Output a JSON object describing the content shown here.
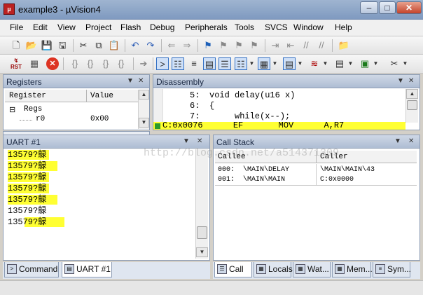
{
  "window": {
    "title": "example3 - µVision4",
    "minimize_glyph": "–",
    "maximize_glyph": "□",
    "close_glyph": "✕"
  },
  "menu": [
    "File",
    "Edit",
    "View",
    "Project",
    "Flash",
    "Debug",
    "Peripherals",
    "Tools",
    "SVCS",
    "Window",
    "Help"
  ],
  "toolbar1": {
    "icons": [
      "new-file-icon",
      "open-folder-icon",
      "save-icon",
      "save-all-icon",
      "cut-icon",
      "copy-icon",
      "paste-icon",
      "undo-icon",
      "redo-icon",
      "nav-back-icon",
      "nav-forward-icon",
      "bookmark-icon",
      "bookmark-prev-icon",
      "bookmark-next-icon",
      "bookmark-clear-icon",
      "indent-icon",
      "unindent-icon",
      "comment-icon",
      "uncomment-icon",
      "find-in-files-icon"
    ]
  },
  "toolbar2": {
    "reset_label": "RST",
    "glyphs": {
      "run": "▦",
      "stop": "✕",
      "step_in": "{}",
      "step_over": "{}",
      "step_out": "{}",
      "run_to_cursor": "{}",
      "show_next": "➔",
      "command_window": ">",
      "disassembly_window": "☷",
      "symbols_window": "≡",
      "registers_window": "▤",
      "call_stack_window": "☰",
      "watch_window": "☷",
      "memory_window": "▦",
      "serial_window": "▤",
      "analysis_window": "≋",
      "trace_window": "▤",
      "system_viewer": "▣",
      "toolbox": "✂"
    }
  },
  "registers": {
    "title": "Registers",
    "col_register": "Register",
    "col_value": "Value",
    "tree_toggle": "⊟",
    "group": "Regs",
    "rows": [
      {
        "name": "r0",
        "value": "0x00"
      }
    ]
  },
  "disassembly": {
    "title": "Disassembly",
    "lines": [
      {
        "num": "5:",
        "code": "void delay(u16 x)"
      },
      {
        "num": "6:",
        "code": "{"
      },
      {
        "num": "7:",
        "code": "     while(x--);"
      }
    ],
    "current_line": "C:0x0076      EF       MOV      A,R7"
  },
  "uart": {
    "title": "UART #1",
    "lines": [
      "13579?鵦",
      "13579?鵦",
      "13579?鵦",
      "13579?鵦",
      "13579?鵦",
      "13579?鵦",
      "13579?鵦"
    ]
  },
  "callstack": {
    "title": "Call Stack",
    "col_callee": "Callee",
    "col_caller": "Caller",
    "rows": [
      {
        "callee": "000:  \\MAIN\\DELAY",
        "caller": "\\MAIN\\MAIN\\43"
      },
      {
        "callee": "001:  \\MAIN\\MAIN",
        "caller": "C:0x0000"
      }
    ]
  },
  "bottom_tabs_left": [
    "Command",
    "UART #1"
  ],
  "bottom_tabs_right": [
    "Call ...",
    "Locals",
    "Wat...",
    "Mem...",
    "Sym..."
  ],
  "watermark": "http://blog.csdn.net/a514371309",
  "highlight_color": "#ffff33"
}
